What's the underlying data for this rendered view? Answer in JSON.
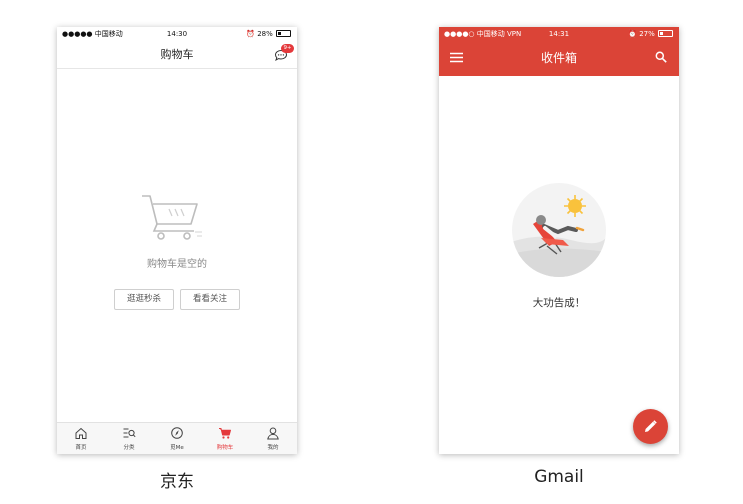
{
  "jd": {
    "status": {
      "carrier": "●●●●● 中国移动 ",
      "time": "14:30",
      "right": "⏰ 28%"
    },
    "nav_title": "购物车",
    "msg_badge": "9+",
    "empty_text": "购物车是空的",
    "buttons": [
      "逛逛秒杀",
      "看看关注"
    ],
    "tabs": [
      {
        "label": "首页",
        "icon": "home-icon"
      },
      {
        "label": "分类",
        "icon": "category-icon"
      },
      {
        "label": "觅Me",
        "icon": "compass-icon"
      },
      {
        "label": "购物车",
        "icon": "cart-icon",
        "active": true
      },
      {
        "label": "我的",
        "icon": "profile-icon"
      }
    ],
    "caption": "京东",
    "accent": "#e4393c"
  },
  "gmail": {
    "status": {
      "carrier": "●●●●○ 中国移动 VPN",
      "time": "14:31",
      "right": "⏰ 27%"
    },
    "title": "收件箱",
    "done_text": "大功告成！",
    "caption": "Gmail",
    "accent": "#db4437"
  }
}
